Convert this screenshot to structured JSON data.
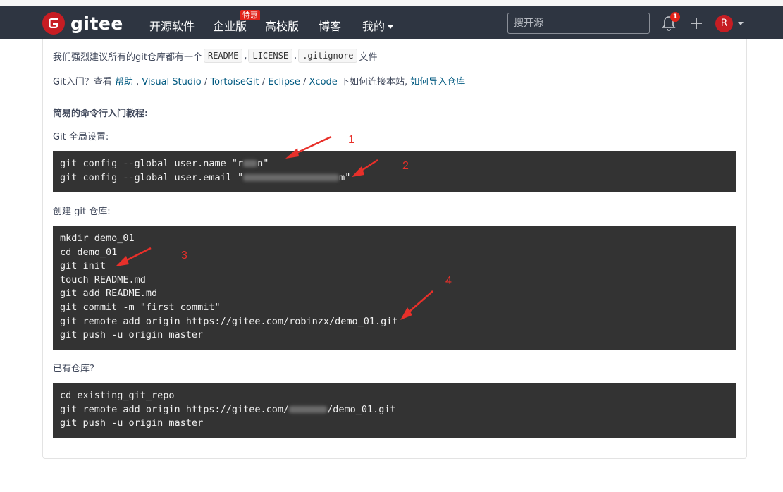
{
  "header": {
    "logo_text": "gitee",
    "nav": [
      {
        "label": "开源软件"
      },
      {
        "label": "企业版"
      },
      {
        "label": "高校版"
      },
      {
        "label": "博客"
      },
      {
        "label": "我的"
      }
    ],
    "promo_badge": "特惠",
    "search_placeholder": "搜开源",
    "notification_count": "1",
    "avatar_letter": "R",
    "brand_color": "#c71d23",
    "bar_color": "#2e3541"
  },
  "intro": {
    "text_before": "我们强烈建议所有的git仓库都有一个",
    "files": [
      "README",
      "LICENSE",
      ".gitignore"
    ],
    "text_after": "文件",
    "sep": ","
  },
  "help": {
    "prefix": "Git入门？查看",
    "help_link": "帮助",
    "tools": [
      "Visual Studio",
      "TortoiseGit",
      "Eclipse",
      "Xcode"
    ],
    "suffix": "下如何连接本站,",
    "import_link": "如何导入仓库"
  },
  "tutorial": {
    "heading": "简易的命令行入门教程:",
    "global_label": "Git 全局设置:",
    "global_lines": [
      "git config --global user.name \"r",
      "git config --global user.email \""
    ],
    "global_name_tail": "n\"",
    "global_email_tail": "m\"",
    "create_label": "创建 git 仓库:",
    "create_lines": [
      "mkdir demo_01",
      "cd demo_01",
      "git init",
      "touch README.md",
      "git add README.md",
      "git commit -m \"first commit\"",
      "git remote add origin https://gitee.com/robinzx/demo_01.git",
      "git push -u origin master"
    ],
    "existing_label": "已有仓库?",
    "existing_lines": [
      "cd existing_git_repo",
      "git remote add origin https://gitee.com/",
      "git push -u origin master"
    ],
    "existing_remote_tail": "/demo_01.git"
  },
  "annotations": {
    "numbers": [
      "1",
      "2",
      "3",
      "4"
    ],
    "color": "#e8302a"
  }
}
